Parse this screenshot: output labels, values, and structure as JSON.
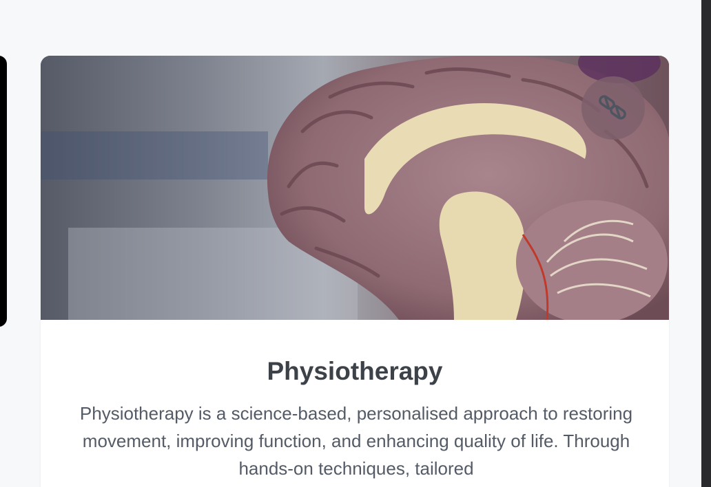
{
  "service": {
    "title": "Physiotherapy",
    "description": "Physiotherapy is a science-based, personalised approach to restoring movement, improving function, and enhancing quality of life. Through hands-on techniques, tailored",
    "image": {
      "subject": "anatomical brain model"
    },
    "badge": {
      "icon": "pills-icon"
    }
  },
  "colors": {
    "page_background": "#f7f8fa",
    "card_background": "#ffffff",
    "title": "#3d4249",
    "description": "#545b66"
  }
}
